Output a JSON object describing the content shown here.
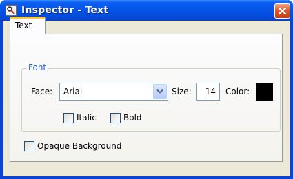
{
  "window": {
    "title": "Inspector - Text"
  },
  "tabs": [
    {
      "label": "Text",
      "selected": true
    }
  ],
  "font_group": {
    "legend": "Font",
    "face_label": "Face:",
    "face_value": "Arial",
    "size_label": "Size:",
    "size_value": "14",
    "color_label": "Color:",
    "color_value": "#000000",
    "italic_label": "Italic",
    "italic_checked": false,
    "bold_label": "Bold",
    "bold_checked": false
  },
  "opaque_background": {
    "label": "Opaque Background",
    "checked": false
  },
  "icons": {
    "title": "inspector-app-icon",
    "close": "close-icon",
    "dropdown": "chevron-down-icon"
  },
  "colors": {
    "titlebar": "#0554e8",
    "close_button": "#e0552c",
    "group_legend": "#1c5ae4",
    "tab_highlight": "#ffc83c"
  }
}
